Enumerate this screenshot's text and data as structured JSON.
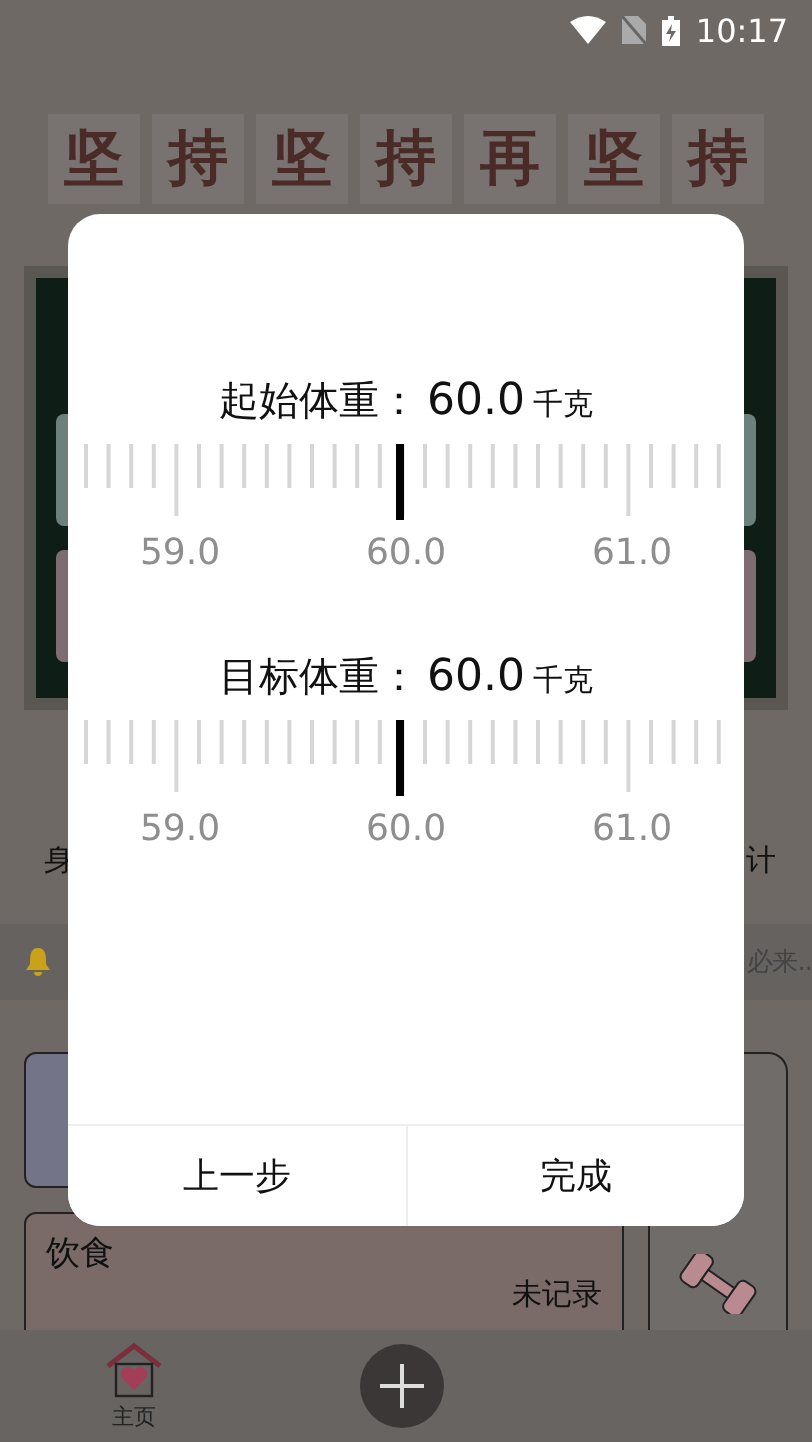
{
  "status_bar": {
    "time": "10:17"
  },
  "banner": {
    "characters": [
      "坚",
      "持",
      "坚",
      "持",
      "再",
      "坚",
      "持"
    ]
  },
  "board": {
    "left_label": "身",
    "right_label": "计"
  },
  "notice": {
    "text": "必来.."
  },
  "diet_card": {
    "title": "饮食",
    "status": "未记录"
  },
  "bottom_nav": {
    "items": [
      {
        "label": "主页"
      }
    ]
  },
  "dialog": {
    "pickers": [
      {
        "label": "起始体重：",
        "value": "60.0",
        "unit": "千克",
        "tick_labels": [
          "59.0",
          "60.0",
          "61.0"
        ]
      },
      {
        "label": "目标体重：",
        "value": "60.0",
        "unit": "千克",
        "tick_labels": [
          "59.0",
          "60.0",
          "61.0"
        ]
      }
    ],
    "buttons": [
      {
        "label": "上一步"
      },
      {
        "label": "完成"
      }
    ]
  }
}
